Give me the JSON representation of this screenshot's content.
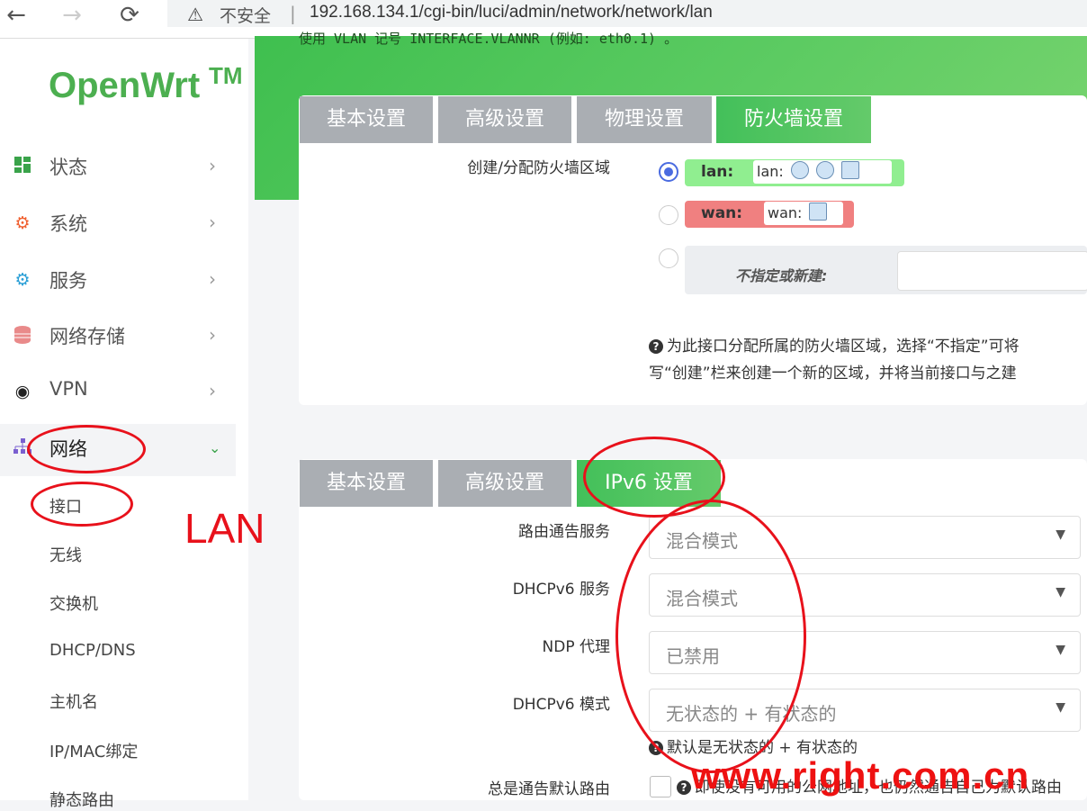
{
  "browser": {
    "warning_icon": "warning-icon",
    "security_label": "不安全",
    "separator": "|",
    "url": "192.168.134.1/cgi-bin/luci/admin/network/network/lan"
  },
  "sidebar": {
    "logo": "OpenWrt",
    "logo_tm": "TM",
    "items": [
      {
        "label": "状态",
        "icon": "dashboard-icon"
      },
      {
        "label": "系统",
        "icon": "gear-icon"
      },
      {
        "label": "服务",
        "icon": "services-icon"
      },
      {
        "label": "网络存储",
        "icon": "database-icon"
      },
      {
        "label": "VPN",
        "icon": "globe-icon"
      },
      {
        "label": "网络",
        "icon": "network-icon"
      }
    ],
    "subitems": [
      "接口",
      "无线",
      "交换机",
      "DHCP/DNS",
      "主机名",
      "IP/MAC绑定",
      "静态路由"
    ]
  },
  "top_note": "使用 VLAN 记号 INTERFACE.VLANNR (例如: eth0.1) 。",
  "panel1": {
    "tabs": [
      "基本设置",
      "高级设置",
      "物理设置",
      "防火墙设置"
    ],
    "field_label": "创建/分配防火墙区域",
    "zones": [
      {
        "name": "lan:",
        "chip": "lan:",
        "color": "#90ee90"
      },
      {
        "name": "wan:",
        "chip": "wan:",
        "color": "#f08080"
      }
    ],
    "unspecified_label": "不指定或新建:",
    "help_line1": "为此接口分配所属的防火墙区域，选择“不指定”可将",
    "help_line2": "写“创建”栏来创建一个新的区域，并将当前接口与之建"
  },
  "panel2": {
    "tabs": [
      "基本设置",
      "高级设置",
      "IPv6 设置"
    ],
    "fields": [
      {
        "label": "路由通告服务",
        "value": "混合模式"
      },
      {
        "label": "DHCPv6 服务",
        "value": "混合模式"
      },
      {
        "label": "NDP 代理",
        "value": "已禁用"
      },
      {
        "label": "DHCPv6 模式",
        "value": "无状态的 + 有状态的"
      }
    ],
    "mode_help": "默认是无状态的 + 有状态的",
    "default_route_label": "总是通告默认路由",
    "default_route_help": "即使没有可用的公网地址，也仍然通告自己为默认路由"
  },
  "annotations": {
    "lan_text": "LAN",
    "watermark": "www.right.com.cn"
  },
  "colors": {
    "accent": "#4caf50",
    "annotation_red": "#e8111b",
    "tab_inactive": "#aaaeb3"
  }
}
